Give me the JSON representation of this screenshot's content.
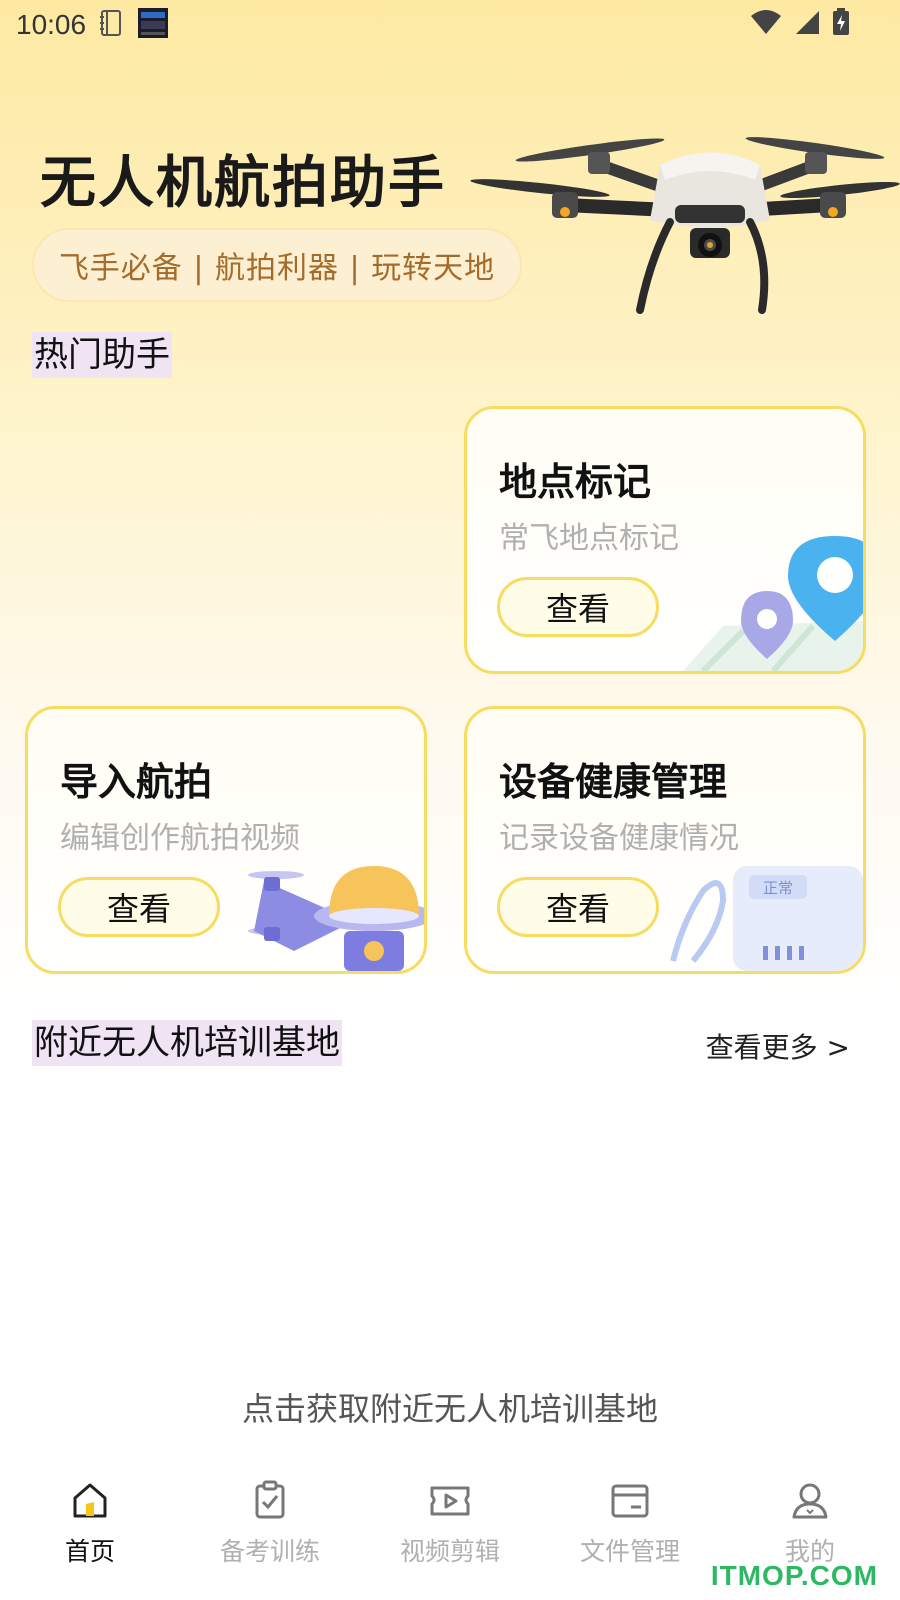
{
  "status_bar": {
    "time": "10:06"
  },
  "hero": {
    "title": "无人机航拍助手",
    "tagline": "飞手必备 | 航拍利器 | 玩转天地"
  },
  "hot_section": {
    "title": "热门助手"
  },
  "cards": [
    {
      "title": "地点标记",
      "subtitle": "常飞地点标记",
      "button": "查看"
    },
    {
      "title": "导入航拍",
      "subtitle": "编辑创作航拍视频",
      "button": "查看"
    },
    {
      "title": "设备健康管理",
      "subtitle": "记录设备健康情况",
      "button": "查看",
      "badge": "正常"
    }
  ],
  "nearby_section": {
    "title": "附近无人机培训基地",
    "more_label": "查看更多 >",
    "hint": "点击获取附近无人机培训基地"
  },
  "tabbar": {
    "items": [
      {
        "label": "首页",
        "icon": "home-icon",
        "active": true
      },
      {
        "label": "备考训练",
        "icon": "clipboard-check-icon",
        "active": false
      },
      {
        "label": "视频剪辑",
        "icon": "video-icon",
        "active": false
      },
      {
        "label": "文件管理",
        "icon": "folder-card-icon",
        "active": false
      },
      {
        "label": "我的",
        "icon": "user-icon",
        "active": false
      }
    ]
  },
  "watermark": "ITMOP.COM",
  "colors": {
    "accent_yellow": "#f7dc62",
    "tagline_text": "#a56b2a",
    "muted_text": "#b0b0b0"
  }
}
